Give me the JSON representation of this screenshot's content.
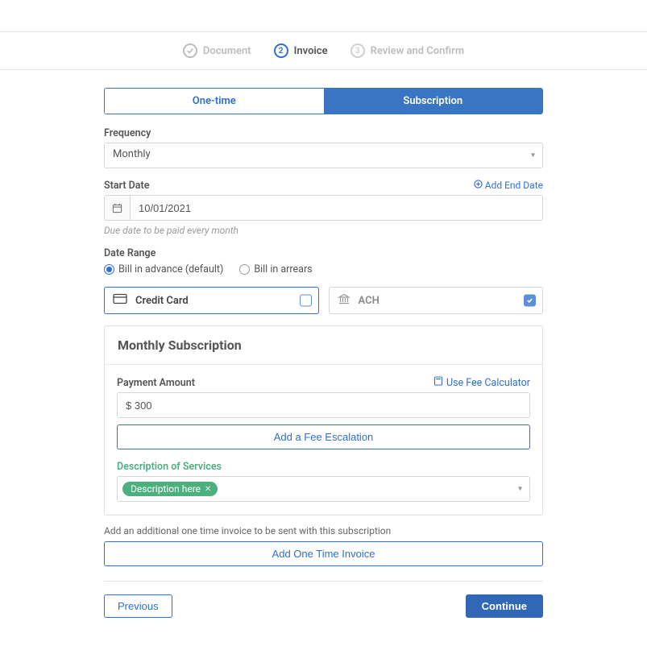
{
  "stepper": {
    "step1": "Document",
    "step2_num": "2",
    "step2": "Invoice",
    "step3_num": "3",
    "step3": "Review and Confirm"
  },
  "tabs": {
    "onetime": "One-time",
    "subscription": "Subscription"
  },
  "frequency": {
    "label": "Frequency",
    "value": "Monthly"
  },
  "startDate": {
    "label": "Start Date",
    "value": "10/01/2021",
    "hint": "Due date to be paid every month",
    "addEndDate": "Add End Date"
  },
  "dateRange": {
    "label": "Date Range",
    "advance": "Bill in advance (default)",
    "arrears": "Bill in arrears"
  },
  "paymentMethods": {
    "credit": "Credit Card",
    "ach": "ACH"
  },
  "panel": {
    "title": "Monthly Subscription",
    "paymentAmountLabel": "Payment Amount",
    "paymentAmountValue": "$ 300",
    "feeCalc": "Use Fee Calculator",
    "addFeeEscalation": "Add a Fee Escalation",
    "descLabel": "Description of Services",
    "tag": "Description here"
  },
  "additional": {
    "note": "Add an additional one time invoice to be sent with this subscription",
    "addOneTime": "Add One Time Invoice"
  },
  "footer": {
    "previous": "Previous",
    "continue": "Continue"
  }
}
